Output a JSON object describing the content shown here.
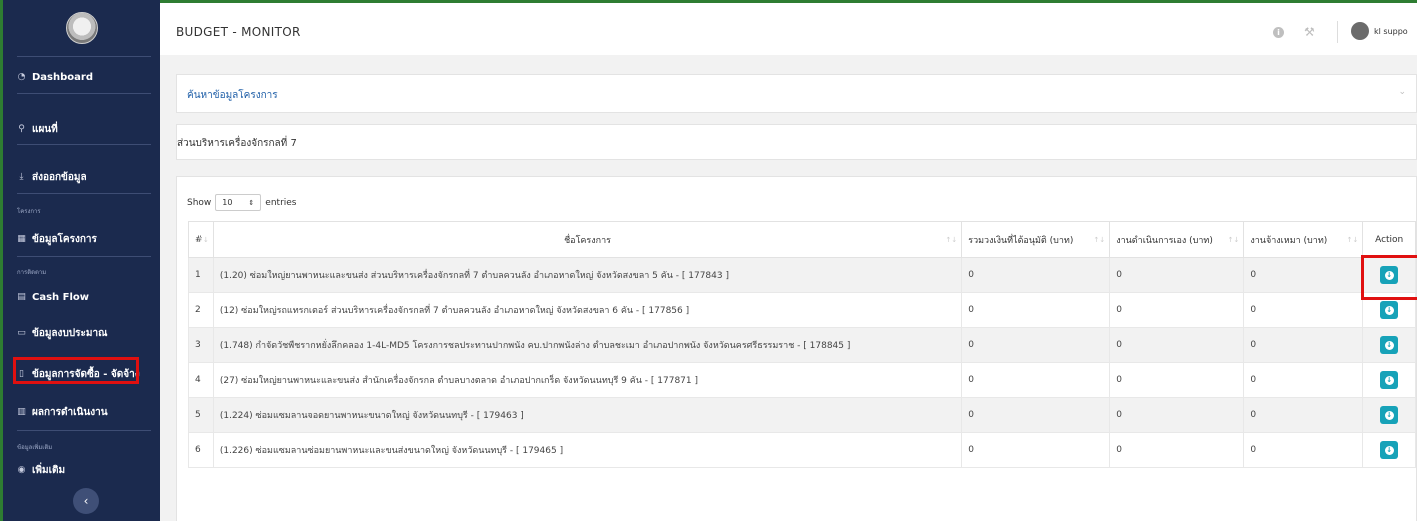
{
  "app": {
    "title": "BUDGET - MONITOR"
  },
  "header": {
    "user_name": "kl suppo",
    "info_icon": "info-icon",
    "settings_icon": "wrench-icon"
  },
  "sidebar": {
    "items": [
      {
        "label": "Dashboard",
        "icon": "dashboard-icon"
      },
      {
        "label": "แผนที่",
        "icon": "map-pin-icon"
      },
      {
        "label": "ส่งออกข้อมูล",
        "icon": "export-icon"
      },
      {
        "label": "ข้อมูลโครงการ",
        "icon": "table-icon"
      },
      {
        "label": "Cash Flow",
        "icon": "cash-flow-icon"
      },
      {
        "label": "ข้อมูลงบประมาณ",
        "icon": "budget-icon"
      },
      {
        "label": "ข้อมูลการจัดซื้อ - จัดจ้าง",
        "icon": "document-icon"
      },
      {
        "label": "ผลการดำเนินงาน",
        "icon": "chart-icon"
      },
      {
        "label": "เพิ่มเติม",
        "icon": "help-icon"
      }
    ],
    "sections": {
      "projects": "โครงการ",
      "tracking": "การติดตาม",
      "additional": "ข้อมูลเพิ่มเติม"
    }
  },
  "search_panel": {
    "title": "ค้นหาข้อมูลโครงการ"
  },
  "agency_panel": {
    "title": "ส่วนบริหารเครื่องจักรกลที่ 7"
  },
  "table": {
    "show_label": "Show",
    "entries_value": "10",
    "entries_label": "entries",
    "columns": [
      "#",
      "ชื่อโครงการ",
      "รวมวงเงินที่ได้อนุมัติ (บาท)",
      "งานดำเนินการเอง (บาท)",
      "งานจ้างเหมา (บาท)",
      "Action"
    ],
    "rows": [
      {
        "num": "1",
        "name": "(1.20) ซ่อมใหญ่ยานพาหนะและขนส่ง ส่วนบริหารเครื่องจักรกลที่ 7 ตำบลควนลัง อำเภอหาดใหญ่ จังหวัดสงขลา 5 คัน - [ 177843 ]",
        "approved": "0",
        "self": "0",
        "contract": "0"
      },
      {
        "num": "2",
        "name": "(12) ซ่อมใหญ่รถแทรกเตอร์ ส่วนบริหารเครื่องจักรกลที่ 7 ตำบลควนลัง อำเภอหาดใหญ่ จังหวัดสงขลา 6 คัน - [ 177856 ]",
        "approved": "0",
        "self": "0",
        "contract": "0"
      },
      {
        "num": "3",
        "name": "(1.748) กำจัดวัชพืชรากหยั่งลึกคลอง 1-4L-MD5 โครงการชลประทานปากพนัง คบ.ปากพนังล่าง ตำบลชะเมา อำเภอปากพนัง จังหวัดนครศรีธรรมราช - [ 178845 ]",
        "approved": "0",
        "self": "0",
        "contract": "0"
      },
      {
        "num": "4",
        "name": "(27) ซ่อมใหญ่ยานพาหนะและขนส่ง สำนักเครื่องจักรกล ตำบลบางตลาด อำเภอปากเกร็ด จังหวัดนนทบุรี 9 คัน - [ 177871 ]",
        "approved": "0",
        "self": "0",
        "contract": "0"
      },
      {
        "num": "5",
        "name": "(1.224) ซ่อมแซมลานจอดยานพาหนะขนาดใหญ่ จังหวัดนนทบุรี - [ 179463 ]",
        "approved": "0",
        "self": "0",
        "contract": "0"
      },
      {
        "num": "6",
        "name": "(1.226) ซ่อมแซมลานซ่อมยานพาหนะและขนส่งขนาดใหญ่ จังหวัดนนทบุรี - [ 179465 ]",
        "approved": "0",
        "self": "0",
        "contract": "0"
      }
    ]
  },
  "colors": {
    "sidebar_bg": "#1b2a4e",
    "accent": "#17a2b8",
    "highlight": "#e01010",
    "link": "#1f5fa8"
  }
}
